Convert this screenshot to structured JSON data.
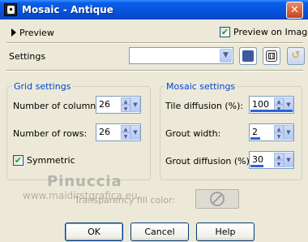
{
  "window": {
    "title": "Mosaic - Antique",
    "close_glyph": "✕"
  },
  "preview": {
    "label": "Preview",
    "preview_on_image_label": "Preview on Image",
    "preview_on_image_checked": true
  },
  "settings": {
    "label": "Settings",
    "preset_value": ""
  },
  "grid": {
    "title": "Grid settings",
    "columns_label": "Number of columns:",
    "columns_value": "26",
    "rows_label": "Number of rows:",
    "rows_value": "26",
    "symmetric_label": "Symmetric",
    "symmetric_checked": true
  },
  "mosaic": {
    "title": "Mosaic settings",
    "tile_diffusion_label": "Tile diffusion (%):",
    "tile_diffusion_value": "100",
    "grout_width_label": "Grout width:",
    "grout_width_value": "2",
    "grout_diffusion_label": "Grout diffusion (%):",
    "grout_diffusion_value": "30"
  },
  "transparency": {
    "label": "Transparency fill color:"
  },
  "watermark": {
    "name": "Pinuccia",
    "url": "www.maidirstgrafica.eu"
  },
  "buttons": {
    "ok": "OK",
    "cancel": "Cancel",
    "help": "Help"
  },
  "icons": {
    "save": "save-icon",
    "dice": "dice-icon",
    "reset": "reset-icon",
    "no_color": "no-color-icon"
  }
}
